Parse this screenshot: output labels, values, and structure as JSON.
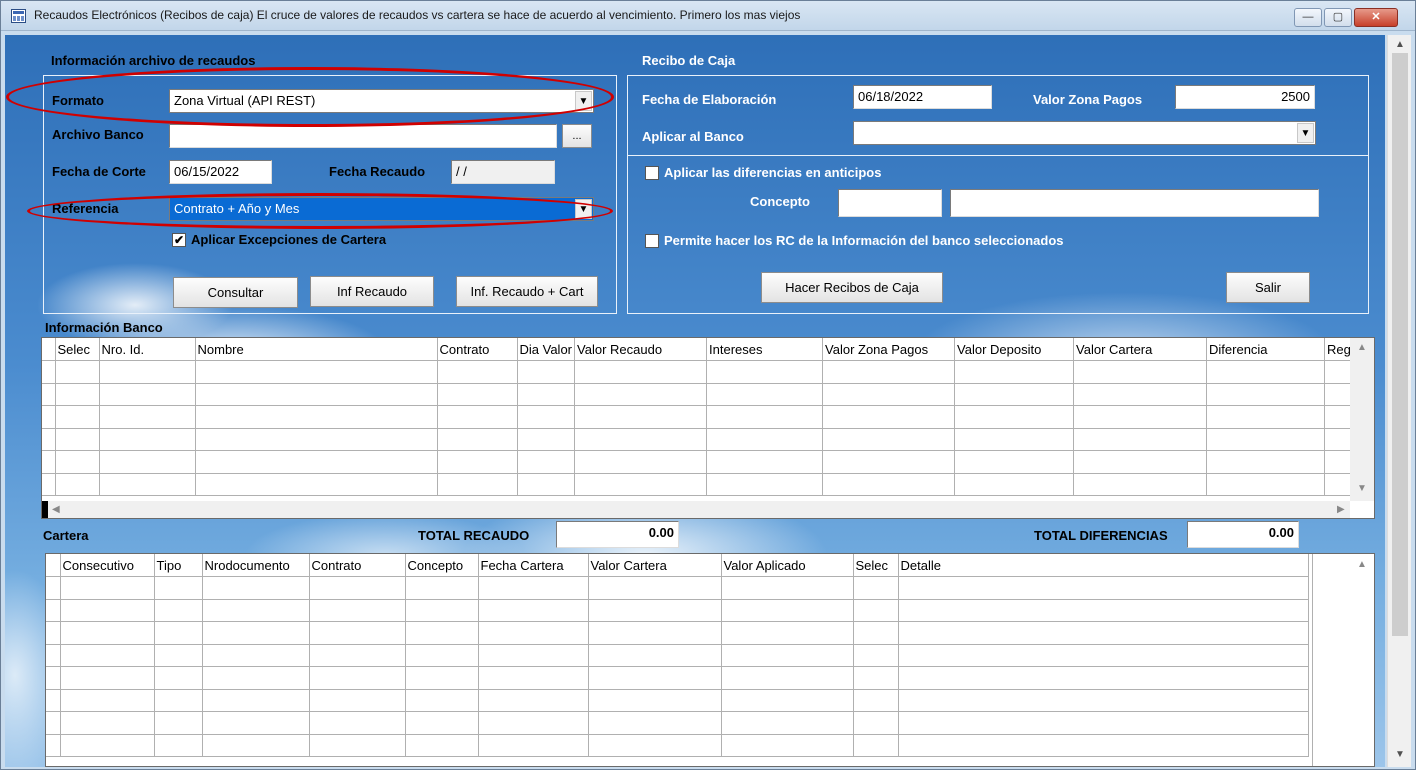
{
  "window": {
    "title": "Recaudos Electrónicos (Recibos de caja) El  cruce de valores de recaudos vs cartera se hace de acuerdo al vencimiento. Primero los mas viejos",
    "controls": {
      "minimize": "—",
      "maximize": "▢",
      "close": "✕"
    }
  },
  "archivo": {
    "section_title": "Información archivo de recaudos",
    "formato_label": "Formato",
    "formato_value": "Zona Virtual (API REST)",
    "archivo_label": "Archivo Banco",
    "archivo_value": "",
    "browse_label": "...",
    "fecha_corte_label": "Fecha de Corte",
    "fecha_corte_value": "06/15/2022",
    "fecha_recaudo_label": "Fecha Recaudo",
    "fecha_recaudo_value": " / /",
    "referencia_label": "Referencia",
    "referencia_value": "Contrato + Año y Mes",
    "excepciones_label": "Aplicar Excepciones de Cartera",
    "excepciones_checked": true,
    "btn_consultar": "Consultar",
    "btn_inf_recaudo": "Inf Recaudo",
    "btn_inf_recaudo_cart": "Inf. Recaudo + Cart"
  },
  "recibo": {
    "section_title": "Recibo de Caja",
    "fecha_elab_label": "Fecha de Elaboración",
    "fecha_elab_value": "06/18/2022",
    "valor_zona_label": "Valor Zona Pagos",
    "valor_zona_value": "2500",
    "aplicar_banco_label": "Aplicar al Banco",
    "aplicar_banco_value": "",
    "diferencias_label": "Aplicar las diferencias en anticipos",
    "concepto_label": "Concepto",
    "concepto_code": "",
    "concepto_desc": "",
    "permite_label": "Permite hacer los RC de la Información del banco seleccionados",
    "btn_hacer": "Hacer Recibos de Caja",
    "btn_salir": "Salir"
  },
  "banco": {
    "section_title": "Información Banco",
    "columns": [
      "Selec",
      "Nro. Id.",
      "Nombre",
      "Contrato",
      "Dia Valor",
      "Valor Recaudo",
      "Intereses",
      "Valor Zona Pagos",
      "Valor Deposito",
      "Valor Cartera",
      "Diferencia",
      "Reg"
    ]
  },
  "cartera": {
    "section_title": "Cartera",
    "total_recaudo_label": "TOTAL RECAUDO",
    "total_recaudo_value": "0.00",
    "total_dif_label": "TOTAL DIFERENCIAS",
    "total_dif_value": "0.00",
    "columns": [
      "Consecutivo",
      "Tipo",
      "Nrodocumento",
      "Contrato",
      "Concepto",
      "Fecha Cartera",
      "Valor Cartera",
      "Valor Aplicado",
      "Selec",
      "Detalle"
    ]
  },
  "icons": {
    "combo_arrow": "▼",
    "check": "✔",
    "scroll_up": "▲",
    "scroll_down": "▼",
    "scroll_left": "◀",
    "scroll_right": "▶"
  },
  "colors": {
    "highlight_oval": "#d00000",
    "selected_combo": "#0a6bd4"
  }
}
